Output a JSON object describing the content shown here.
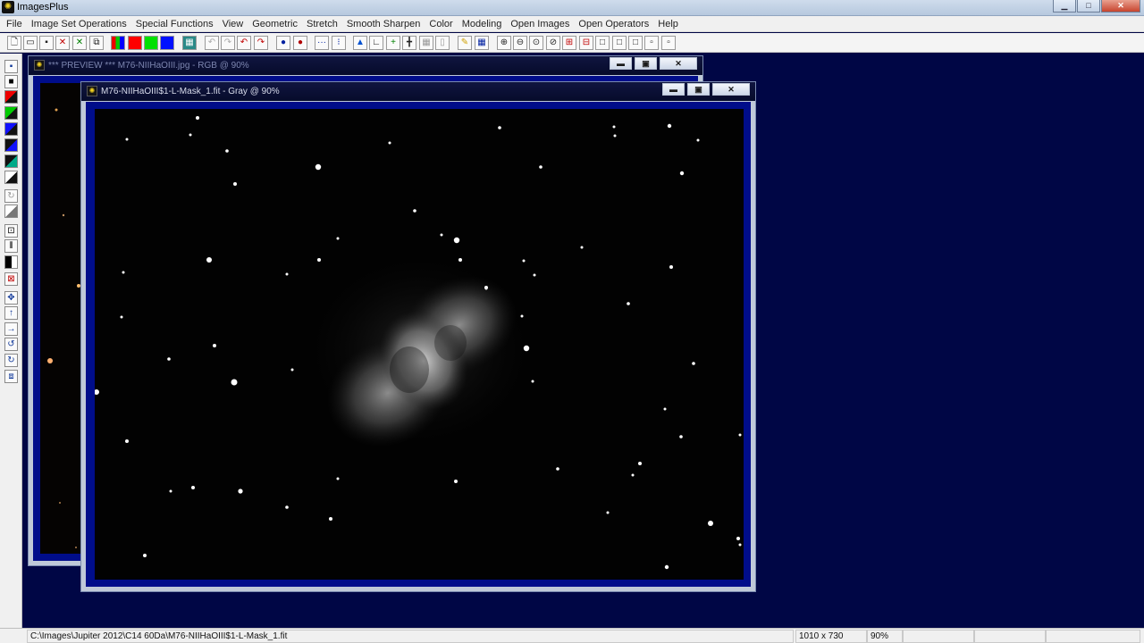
{
  "app": {
    "title": "ImagesPlus",
    "icon": "app-icon"
  },
  "menu": [
    "File",
    "Image Set Operations",
    "Special Functions",
    "View",
    "Geometric",
    "Stretch",
    "Smooth Sharpen",
    "Color",
    "Modeling",
    "Open Images",
    "Open Operators",
    "Help"
  ],
  "windows": {
    "preview": {
      "title": "*** PREVIEW *** M76-NIIHaOIII.jpg - RGB @ 90%"
    },
    "mask": {
      "title": "M76-NIIHaOIII$1-L-Mask_1.fit - Gray @ 90%"
    }
  },
  "status": {
    "path": "C:\\Images\\Jupiter 2012\\C14 60Da\\M76-NIIHaOIII$1-L-Mask_1.fit",
    "dimensions": "1010 x 730",
    "zoom": "90%"
  },
  "colors": {
    "workspace": "#000645",
    "image_border": "#000d8a",
    "preview_title_text": "#7d86b0",
    "active_title_text": "#d8dceb"
  }
}
